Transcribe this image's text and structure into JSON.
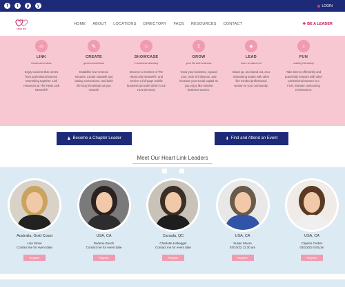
{
  "topbar": {
    "social_icons": [
      "f",
      "t",
      "p",
      "y"
    ],
    "social_icon_names": [
      "facebook-icon",
      "twitter-icon",
      "pinterest-icon",
      "youtube-icon"
    ],
    "login_label": "LOGIN"
  },
  "nav": {
    "logo_text": "heart link",
    "items": [
      "HOME",
      "ABOUT",
      "LOCATIONS",
      "DIRECTORY",
      "FAQS",
      "RESOURCES",
      "CONTACT"
    ],
    "leader_link": "BE A LEADER"
  },
  "features": [
    {
      "icon": "link-icon",
      "glyph": "∞",
      "title": "LINK",
      "sub": "hearts and minds",
      "body": "Enjoy success that comes from professional women networking together. Link resources at The Heart Link Network®"
    },
    {
      "icon": "create-icon",
      "glyph": "✎",
      "title": "CREATE",
      "sub": "great connections",
      "body": "Establish new revenue streams, Create valuable and lasting connections, and build life long friendships as you network"
    },
    {
      "icon": "showcase-icon",
      "glyph": "☆",
      "title": "SHOWCASE",
      "sub": "in business directory",
      "body": "Become a member of The Heart Link Network®, and receive a full-page mobile business ad worth $780 in our HLN Directory"
    },
    {
      "icon": "grow-icon",
      "glyph": "⇧",
      "title": "GROW",
      "sub": "your life and business",
      "body": "Grow your business, expand your circle of influence, and increase your social capital as you enjoy like-minded business women."
    },
    {
      "icon": "lead-icon",
      "glyph": "★",
      "title": "LEAD",
      "sub": "learn to stand out",
      "body": "Stand up, and stand out, as a networking leader with other like minded professional women in your community."
    },
    {
      "icon": "fun-icon",
      "glyph": "♀",
      "title": "FUN",
      "sub": "making friendship",
      "body": "Take time to effectively and powerfully network with other professional women in a FUN, intimate, welcoming environment."
    }
  ],
  "actions": {
    "chapter_leader": "Become a Chapter Leader",
    "find_event": "Find and Attend an Event"
  },
  "leaders_section": {
    "title": "Meet Our Heart Link Leaders",
    "people": [
      {
        "location": "Australia, Gold Coast",
        "name": "Lisa Stone",
        "contact": "Contact me for event date",
        "button": "Register",
        "hair": "#c9a460",
        "shirt": "#222222",
        "bg": "#d9d2c8"
      },
      {
        "location": "USA, CA",
        "name": "Darlene Bosch",
        "contact": "Contact me for event date",
        "button": "Register",
        "hair": "#2a2220",
        "shirt": "#2d2d2d",
        "bg": "#7a7a7a"
      },
      {
        "location": "Canada, QC",
        "name": "Charlotte Habegger",
        "contact": "Contact me for event date",
        "button": "Register",
        "hair": "#3a2f26",
        "shirt": "#1e1e1e",
        "bg": "#c8c2b8"
      },
      {
        "location": "USA, CA",
        "name": "Susan Moore",
        "contact": "03/10/22 11:30 am",
        "button": "Register",
        "hair": "#6a5a4a",
        "shirt": "#3055a8",
        "bg": "#e8e8e8"
      },
      {
        "location": "USA, CA",
        "name": "Caprice Crebar",
        "contact": "03/10/22 6:00 pm",
        "button": "Register",
        "hair": "#5a3a22",
        "shirt": "#efefef",
        "bg": "#f0ebe6"
      }
    ]
  },
  "colors": {
    "navy": "#1c2a78",
    "pink_bg": "#f7c7d2",
    "pink_accent": "#f09bb0",
    "brand": "#c2185b",
    "light_blue": "#dceaf4"
  }
}
